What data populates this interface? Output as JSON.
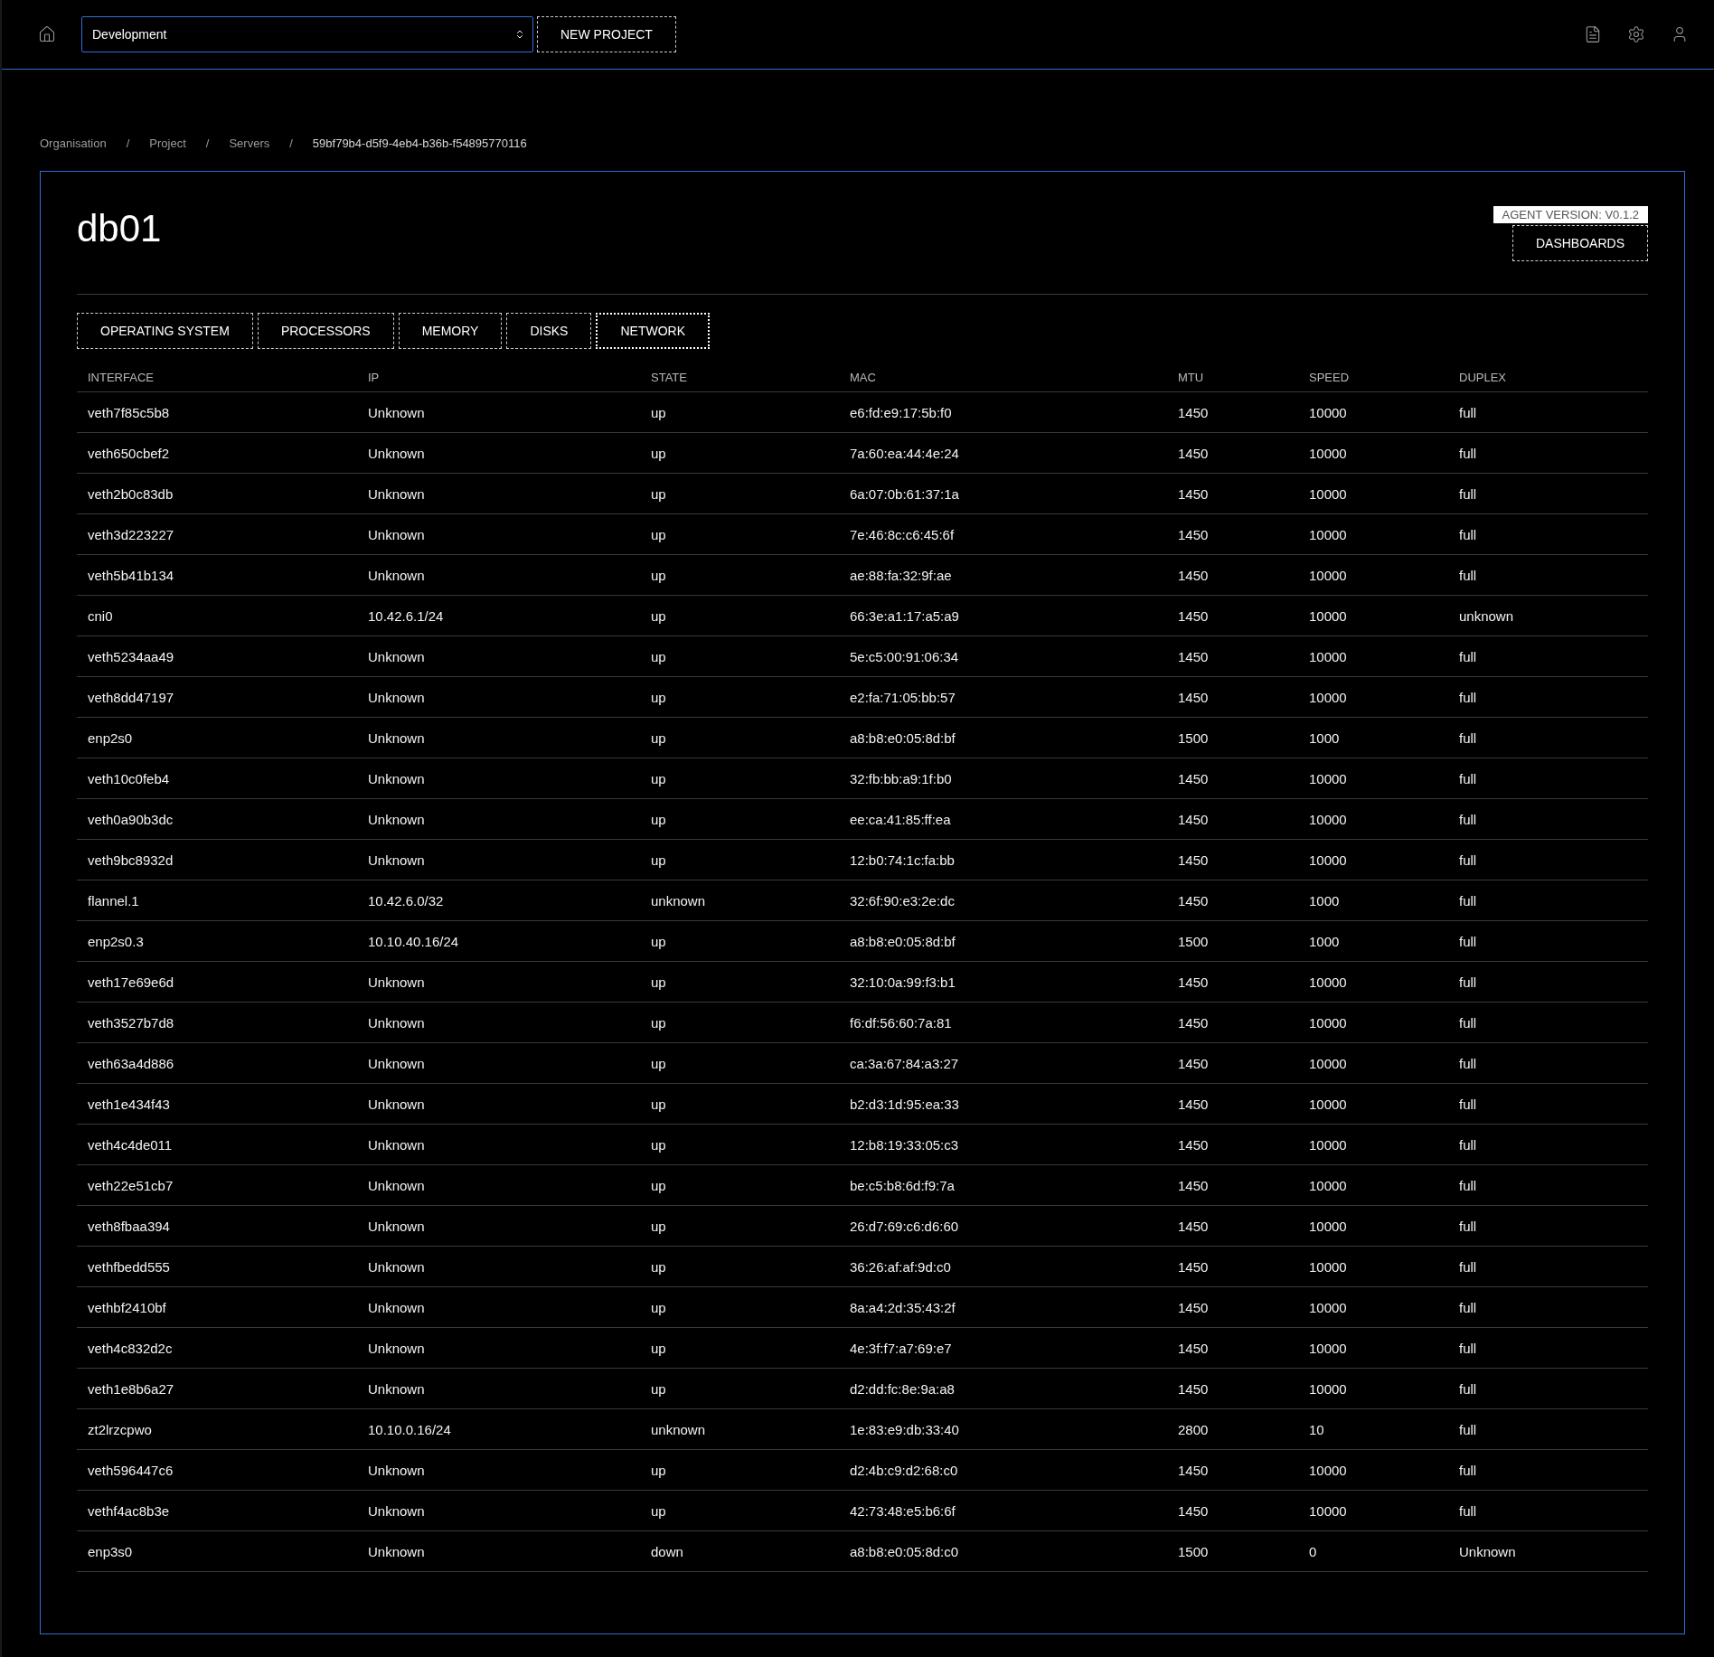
{
  "topbar": {
    "project_select": {
      "value": "Development"
    },
    "new_project_button": "NEW PROJECT"
  },
  "breadcrumb": {
    "separator": "/",
    "items": [
      "Organisation",
      "Project",
      "Servers",
      "59bf79b4-d5f9-4eb4-b36b-f54895770116"
    ]
  },
  "server": {
    "title": "db01",
    "agent_version": "AGENT VERSION: V0.1.2",
    "dashboards_button": "DASHBOARDS"
  },
  "tabs": [
    {
      "label": "OPERATING SYSTEM",
      "selected": false
    },
    {
      "label": "PROCESSORS",
      "selected": false
    },
    {
      "label": "MEMORY",
      "selected": false
    },
    {
      "label": "DISKS",
      "selected": false
    },
    {
      "label": "NETWORK",
      "selected": true
    }
  ],
  "table": {
    "columns": [
      "INTERFACE",
      "IP",
      "STATE",
      "MAC",
      "MTU",
      "SPEED",
      "DUPLEX"
    ],
    "rows": [
      [
        "veth7f85c5b8",
        "Unknown",
        "up",
        "e6:fd:e9:17:5b:f0",
        "1450",
        "10000",
        "full"
      ],
      [
        "veth650cbef2",
        "Unknown",
        "up",
        "7a:60:ea:44:4e:24",
        "1450",
        "10000",
        "full"
      ],
      [
        "veth2b0c83db",
        "Unknown",
        "up",
        "6a:07:0b:61:37:1a",
        "1450",
        "10000",
        "full"
      ],
      [
        "veth3d223227",
        "Unknown",
        "up",
        "7e:46:8c:c6:45:6f",
        "1450",
        "10000",
        "full"
      ],
      [
        "veth5b41b134",
        "Unknown",
        "up",
        "ae:88:fa:32:9f:ae",
        "1450",
        "10000",
        "full"
      ],
      [
        "cni0",
        "10.42.6.1/24",
        "up",
        "66:3e:a1:17:a5:a9",
        "1450",
        "10000",
        "unknown"
      ],
      [
        "veth5234aa49",
        "Unknown",
        "up",
        "5e:c5:00:91:06:34",
        "1450",
        "10000",
        "full"
      ],
      [
        "veth8dd47197",
        "Unknown",
        "up",
        "e2:fa:71:05:bb:57",
        "1450",
        "10000",
        "full"
      ],
      [
        "enp2s0",
        "Unknown",
        "up",
        "a8:b8:e0:05:8d:bf",
        "1500",
        "1000",
        "full"
      ],
      [
        "veth10c0feb4",
        "Unknown",
        "up",
        "32:fb:bb:a9:1f:b0",
        "1450",
        "10000",
        "full"
      ],
      [
        "veth0a90b3dc",
        "Unknown",
        "up",
        "ee:ca:41:85:ff:ea",
        "1450",
        "10000",
        "full"
      ],
      [
        "veth9bc8932d",
        "Unknown",
        "up",
        "12:b0:74:1c:fa:bb",
        "1450",
        "10000",
        "full"
      ],
      [
        "flannel.1",
        "10.42.6.0/32",
        "unknown",
        "32:6f:90:e3:2e:dc",
        "1450",
        "1000",
        "full"
      ],
      [
        "enp2s0.3",
        "10.10.40.16/24",
        "up",
        "a8:b8:e0:05:8d:bf",
        "1500",
        "1000",
        "full"
      ],
      [
        "veth17e69e6d",
        "Unknown",
        "up",
        "32:10:0a:99:f3:b1",
        "1450",
        "10000",
        "full"
      ],
      [
        "veth3527b7d8",
        "Unknown",
        "up",
        "f6:df:56:60:7a:81",
        "1450",
        "10000",
        "full"
      ],
      [
        "veth63a4d886",
        "Unknown",
        "up",
        "ca:3a:67:84:a3:27",
        "1450",
        "10000",
        "full"
      ],
      [
        "veth1e434f43",
        "Unknown",
        "up",
        "b2:d3:1d:95:ea:33",
        "1450",
        "10000",
        "full"
      ],
      [
        "veth4c4de011",
        "Unknown",
        "up",
        "12:b8:19:33:05:c3",
        "1450",
        "10000",
        "full"
      ],
      [
        "veth22e51cb7",
        "Unknown",
        "up",
        "be:c5:b8:6d:f9:7a",
        "1450",
        "10000",
        "full"
      ],
      [
        "veth8fbaa394",
        "Unknown",
        "up",
        "26:d7:69:c6:d6:60",
        "1450",
        "10000",
        "full"
      ],
      [
        "vethfbedd555",
        "Unknown",
        "up",
        "36:26:af:af:9d:c0",
        "1450",
        "10000",
        "full"
      ],
      [
        "vethbf2410bf",
        "Unknown",
        "up",
        "8a:a4:2d:35:43:2f",
        "1450",
        "10000",
        "full"
      ],
      [
        "veth4c832d2c",
        "Unknown",
        "up",
        "4e:3f:f7:a7:69:e7",
        "1450",
        "10000",
        "full"
      ],
      [
        "veth1e8b6a27",
        "Unknown",
        "up",
        "d2:dd:fc:8e:9a:a8",
        "1450",
        "10000",
        "full"
      ],
      [
        "zt2lrzcpwo",
        "10.10.0.16/24",
        "unknown",
        "1e:83:e9:db:33:40",
        "2800",
        "10",
        "full"
      ],
      [
        "veth596447c6",
        "Unknown",
        "up",
        "d2:4b:c9:d2:68:c0",
        "1450",
        "10000",
        "full"
      ],
      [
        "vethf4ac8b3e",
        "Unknown",
        "up",
        "42:73:48:e5:b6:6f",
        "1450",
        "10000",
        "full"
      ],
      [
        "enp3s0",
        "Unknown",
        "down",
        "a8:b8:e0:05:8d:c0",
        "1500",
        "0",
        "Unknown"
      ]
    ]
  }
}
